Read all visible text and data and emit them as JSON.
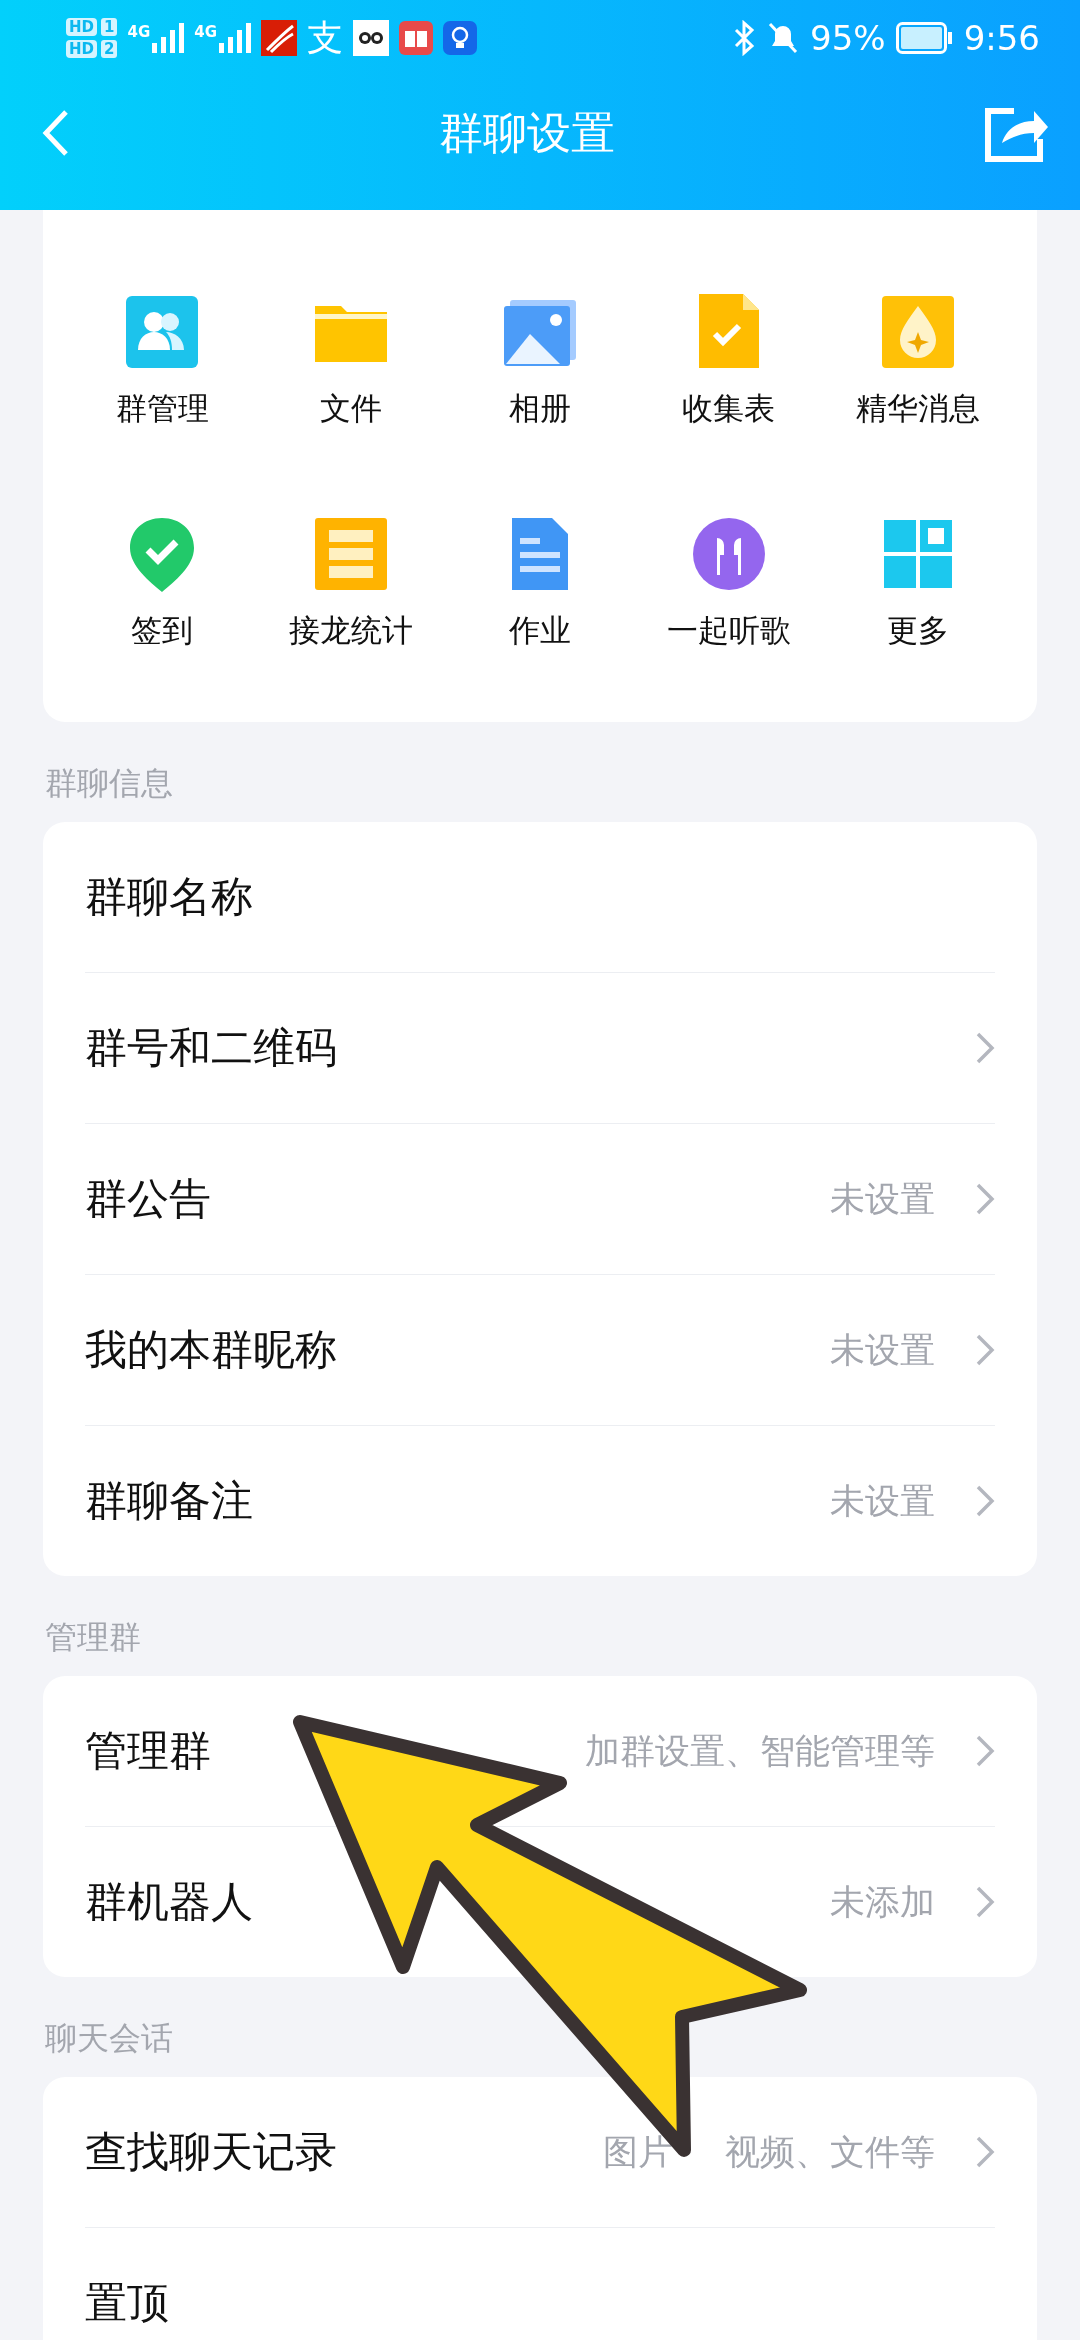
{
  "status_bar": {
    "sims": [
      {
        "badge": "HD",
        "slot": "1",
        "network": "4G"
      },
      {
        "badge": "HD",
        "slot": "2",
        "network": "4G"
      }
    ],
    "notification_glyph": "支",
    "battery": "95%",
    "time": "9:56"
  },
  "header": {
    "title": "群聊设置"
  },
  "apps": [
    {
      "label": "群管理",
      "kind": "people"
    },
    {
      "label": "文件",
      "kind": "folder"
    },
    {
      "label": "相册",
      "kind": "photos"
    },
    {
      "label": "收集表",
      "kind": "form"
    },
    {
      "label": "精华消息",
      "kind": "drop"
    },
    {
      "label": "签到",
      "kind": "pin"
    },
    {
      "label": "接龙统计",
      "kind": "list"
    },
    {
      "label": "作业",
      "kind": "doc"
    },
    {
      "label": "一起听歌",
      "kind": "earphones"
    },
    {
      "label": "更多",
      "kind": "tiles"
    }
  ],
  "sections": [
    {
      "title": "群聊信息",
      "rows": [
        {
          "label": "群聊名称",
          "chevron": false
        },
        {
          "label": "群号和二维码",
          "chevron": true
        },
        {
          "label": "群公告",
          "value": "未设置",
          "chevron": true
        },
        {
          "label": "我的本群昵称",
          "value": "未设置",
          "chevron": true
        },
        {
          "label": "群聊备注",
          "value": "未设置",
          "chevron": true
        }
      ]
    },
    {
      "title": "管理群",
      "rows": [
        {
          "label": "管理群",
          "value": "加群设置、智能管理等",
          "chevron": true
        },
        {
          "label": "群机器人",
          "value": "未添加",
          "chevron": true
        }
      ]
    },
    {
      "title": "聊天会话",
      "rows": [
        {
          "label": "查找聊天记录",
          "value_parts": [
            "图片",
            "视频、文件等"
          ],
          "chevron": true
        },
        {
          "label": "置顶",
          "chevron": false
        }
      ]
    }
  ]
}
